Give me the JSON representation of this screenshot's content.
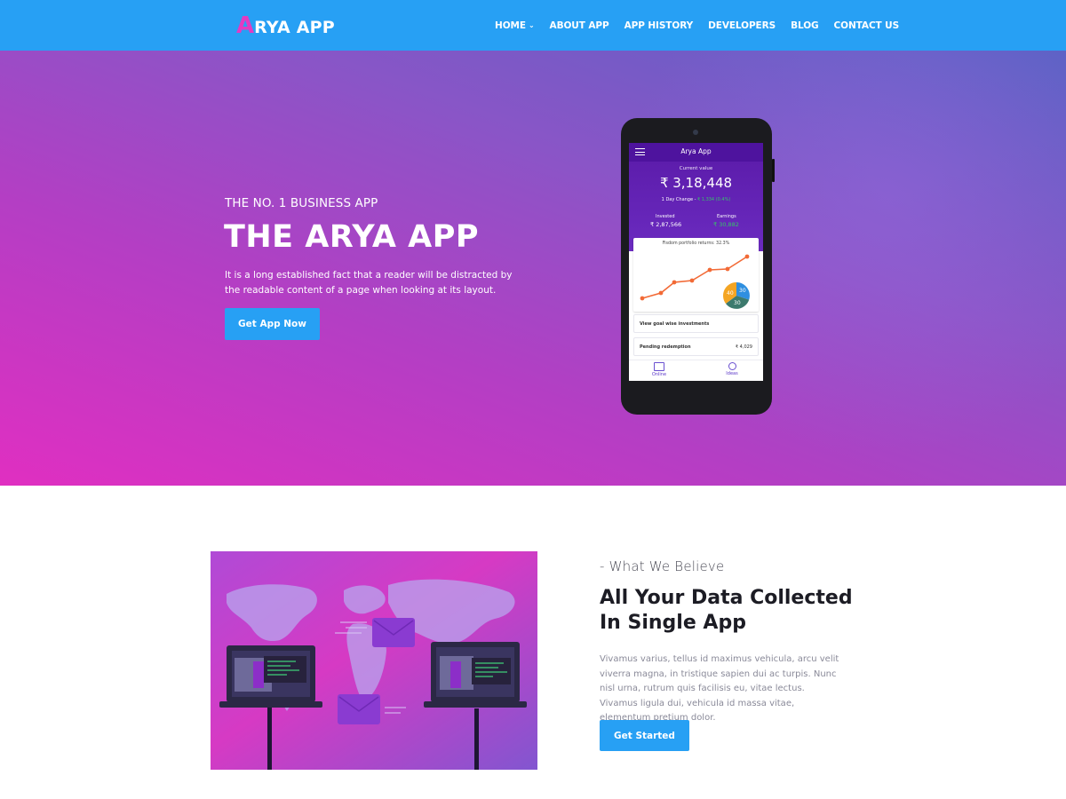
{
  "header": {
    "logo_first": "A",
    "logo_rest": "RYA APP",
    "nav": [
      {
        "label": "HOME"
      },
      {
        "label": "ABOUT APP"
      },
      {
        "label": "APP HISTORY"
      },
      {
        "label": "DEVELOPERS"
      },
      {
        "label": "BLOG"
      },
      {
        "label": "CONTACT US"
      }
    ]
  },
  "hero": {
    "eyebrow": "THE NO. 1 BUSINESS APP",
    "title": "THE ARYA APP",
    "text": "It is a long established fact that a reader will be distracted by the readable content of a page when looking at its layout.",
    "button": "Get App Now"
  },
  "phone": {
    "app_title": "Arya App",
    "current_value_label": "Current value",
    "current_value": "₹ 3,18,448",
    "day_change_label": "1 Day Change - ",
    "day_change_value": "₹ 1,334 (0.4%)",
    "invested_label": "Invested",
    "invested_value": "₹ 2,87,566",
    "earnings_label": "Earnings",
    "earnings_value": "₹ 30,882",
    "chart_label": "Fisdom portfolio returns: 32.3%",
    "pie_labels": [
      "40",
      "30",
      "30"
    ],
    "row1": "View goal wise investments",
    "row2": "Pending redemption",
    "row2_amount": "₹ 4,029",
    "tab1": "Online",
    "tab2": "Ideas"
  },
  "about": {
    "subtitle": "- What We Believe",
    "title": "All Your Data Collected In Single App",
    "text": "Vivamus varius, tellus id maximus vehicula, arcu velit viverra magna, in tristique sapien dui ac turpis. Nunc nisl urna, rutrum quis facilisis eu, vitae lectus. Vivamus ligula dui, vehicula id massa vitae, elementum pretium dolor.",
    "button": "Get Started"
  },
  "colors": {
    "header_bg": "#27a0f4",
    "accent_button": "#27a0f4",
    "logo_accent": "#e33bc2",
    "hero_gradient_start": "#e02fc1",
    "hero_gradient_end": "#5a62c4"
  }
}
